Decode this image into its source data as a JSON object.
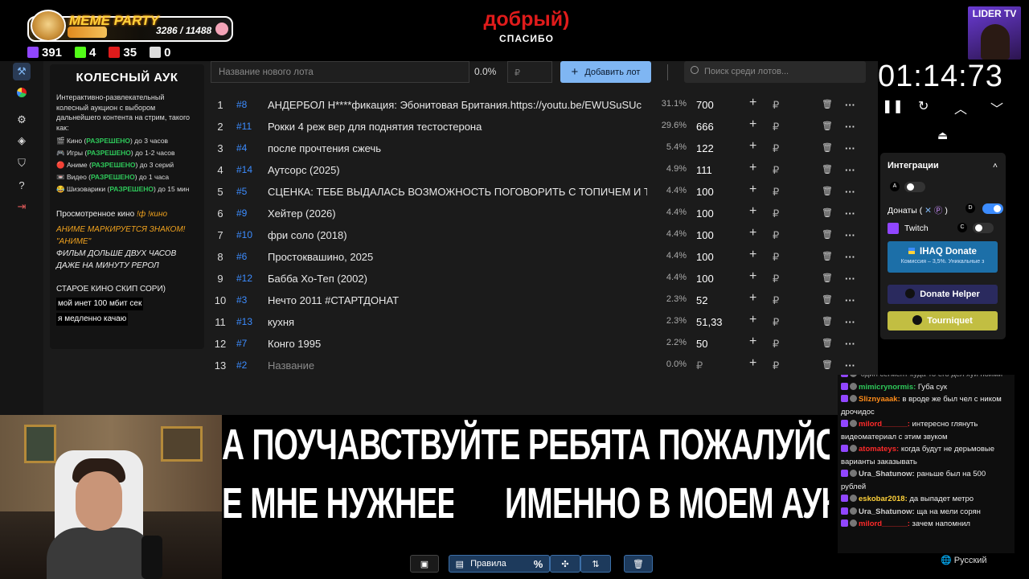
{
  "stream_overlay": {
    "party_title": "MEME PARTY",
    "party_progress": "3286 / 11488",
    "party_progress_fraction": 0.286,
    "stats": [
      {
        "icon": "twitch-icon",
        "value": "391"
      },
      {
        "icon": "kick-icon",
        "value": "4"
      },
      {
        "icon": "live-icon",
        "value": "35"
      },
      {
        "icon": "w-icon",
        "value": "0"
      }
    ],
    "donation_title": "добрый)",
    "donation_subtitle": "СПАСИБО",
    "channel_logo": "LIDER TV"
  },
  "sidebar_icons": [
    "hammer-icon",
    "pie-icon",
    "gear-icon",
    "layers-icon",
    "shield-icon",
    "help-icon",
    "logout-icon"
  ],
  "rules": {
    "title": "КОЛЕСНЫЙ АУК",
    "intro": "Интерактивно-развлекательный колесный аукцион с выбором дальнейшего контента на стрим, такого как:",
    "items": [
      {
        "emoji": "🎬",
        "pre": "Кино (",
        "tag": "РАЗРЕШЕНО",
        "post": ") до 3 часов"
      },
      {
        "emoji": "🎮",
        "pre": "Игры (",
        "tag": "РАЗРЕШЕНО",
        "post": ") до 1-2 часов"
      },
      {
        "emoji": "🔴",
        "pre": "Аниме (",
        "tag": "РАЗРЕШЕНО",
        "post": ") до 3 серий"
      },
      {
        "emoji": "📼",
        "pre": "Видео (",
        "tag": "РАЗРЕШЕНО",
        "post": ") до 1 часа"
      },
      {
        "emoji": "😂",
        "pre": "Шизоварики (",
        "tag": "РАЗРЕШЕНО",
        "post": ") до 15 мин"
      }
    ],
    "watched_label": "Просмотренное кино",
    "watched_cmd": "!ф !кино",
    "anime_warn": "АНИМЕ МАРКИРУЕТСЯ ЗНАКОМ! \"АНИМЕ\"",
    "long_film": "ФИЛЬМ ДОЛЬШЕ ДВУХ ЧАСОВ ДАЖЕ НА МИНУТУ РЕРОЛ",
    "old_films": "СТАРОЕ КИНО СКИП СОРИ)",
    "note_line1": "мой инет 100 мбит сек",
    "note_line2": "я медленно качаю"
  },
  "lot_form": {
    "name_placeholder": "Название нового лота",
    "percent": "0.0%",
    "amount_placeholder": "₽",
    "add_button": "Добавить лот",
    "search_placeholder": "Поиск среди лотов..."
  },
  "lots": [
    {
      "n": "1",
      "id": "#8",
      "name": "АНДЕРБОЛ Н****фикация: Эбонитовая Британия.https://youtu.be/EWUSuSUc",
      "pct": "31.1%",
      "amount": "700"
    },
    {
      "n": "2",
      "id": "#11",
      "name": "Рокки 4 реж вер для поднятия тестостерона",
      "pct": "29.6%",
      "amount": "666"
    },
    {
      "n": "3",
      "id": "#4",
      "name": "после прочтения сжечь",
      "pct": "5.4%",
      "amount": "122"
    },
    {
      "n": "4",
      "id": "#14",
      "name": "Аутсорс (2025)",
      "pct": "4.9%",
      "amount": "111"
    },
    {
      "n": "5",
      "id": "#5",
      "name": "СЦЕНКА: ТЕБЕ ВЫДАЛАСЬ ВОЗМОЖНОСТЬ ПОГОВОРИТЬ С ТОПИЧЕМ И ТЕ",
      "pct": "4.4%",
      "amount": "100"
    },
    {
      "n": "6",
      "id": "#9",
      "name": "Хейтер (2026)",
      "pct": "4.4%",
      "amount": "100"
    },
    {
      "n": "7",
      "id": "#10",
      "name": "фри соло (2018)",
      "pct": "4.4%",
      "amount": "100"
    },
    {
      "n": "8",
      "id": "#6",
      "name": "Простоквашино, 2025",
      "pct": "4.4%",
      "amount": "100"
    },
    {
      "n": "9",
      "id": "#12",
      "name": "Бабба Хо-Теп (2002)",
      "pct": "4.4%",
      "amount": "100"
    },
    {
      "n": "10",
      "id": "#3",
      "name": "Нечто 2011 #СТАРТДОНАТ",
      "pct": "2.3%",
      "amount": "52"
    },
    {
      "n": "11",
      "id": "#13",
      "name": "кухня",
      "pct": "2.3%",
      "amount": "51,33"
    },
    {
      "n": "12",
      "id": "#7",
      "name": "Конго 1995",
      "pct": "2.2%",
      "amount": "50"
    },
    {
      "n": "13",
      "id": "#2",
      "name": "Название",
      "pct": "0.0%",
      "amount": "₽"
    }
  ],
  "row_plus": "+",
  "row_rub": "₽",
  "row_more": "···",
  "timer": {
    "value": "01:14:73",
    "controls": [
      "pause-icon",
      "restart-icon",
      "chevron-up-icon",
      "chevron-down-icon"
    ]
  },
  "integrations": {
    "title": "Интеграции",
    "a_label": "A",
    "donations_label": "Донаты (",
    "donations_label_close": ")",
    "d_label": "D",
    "twitch_label": "Twitch",
    "c_label": "C",
    "ihaq_title": "IHAQ Donate",
    "ihaq_sub": "Комиссия – 3,5%. Уникальные з",
    "donate_helper": "Donate Helper",
    "tourniquet": "Tourniquet"
  },
  "chat": [
    {
      "user": "",
      "text": "один сегмент куда-то его дел хуй пойми",
      "color": "#ccc"
    },
    {
      "user": "mimicrynormis:",
      "text": "Губа сук",
      "color": "#2ec85a"
    },
    {
      "user": "Sliznyaaak:",
      "text": "в вроде же был чел с ником дрочидос",
      "color": "#ff8c1a"
    },
    {
      "user": "milord______:",
      "text": "интересно глянуть видеоматериал с этим звуком",
      "color": "#ff2a2a"
    },
    {
      "user": "atomateys:",
      "text": "когда будут не дерьмовые варианты заказывать",
      "color": "#ff2a2a"
    },
    {
      "user": "Ura_Shatunow:",
      "text": "раньше был на 500 рублей",
      "color": "#cfcfcf"
    },
    {
      "user": "eskobar2018:",
      "text": "да выпадет метро",
      "color": "#ffd23a"
    },
    {
      "user": "Ura_Shatunow:",
      "text": "ща на мели сорян",
      "color": "#cfcfcf"
    },
    {
      "user": "milord______:",
      "text": "зачем напомнил",
      "color": "#ff2a2a"
    }
  ],
  "language": "Русский",
  "subtitles": {
    "line1": "А ПОУЧАВСТВУЙТЕ РЕБЯТА ПОЖАЛУЙСТА",
    "line2a": "Е МНЕ НУЖНЕЕ",
    "line2b": "ИМЕННО В МОЕМ АУК"
  },
  "bottom_bar": {
    "rules_label": "Правила",
    "buttons": [
      "box-icon",
      "rules-icon",
      "percent-icon",
      "split-icon",
      "sort-icon",
      "trash-icon"
    ]
  },
  "colors": {
    "accent": "#7fb6f3",
    "id_blue": "#3c8cff",
    "green": "#2ec85a",
    "red": "#e01b1b"
  }
}
